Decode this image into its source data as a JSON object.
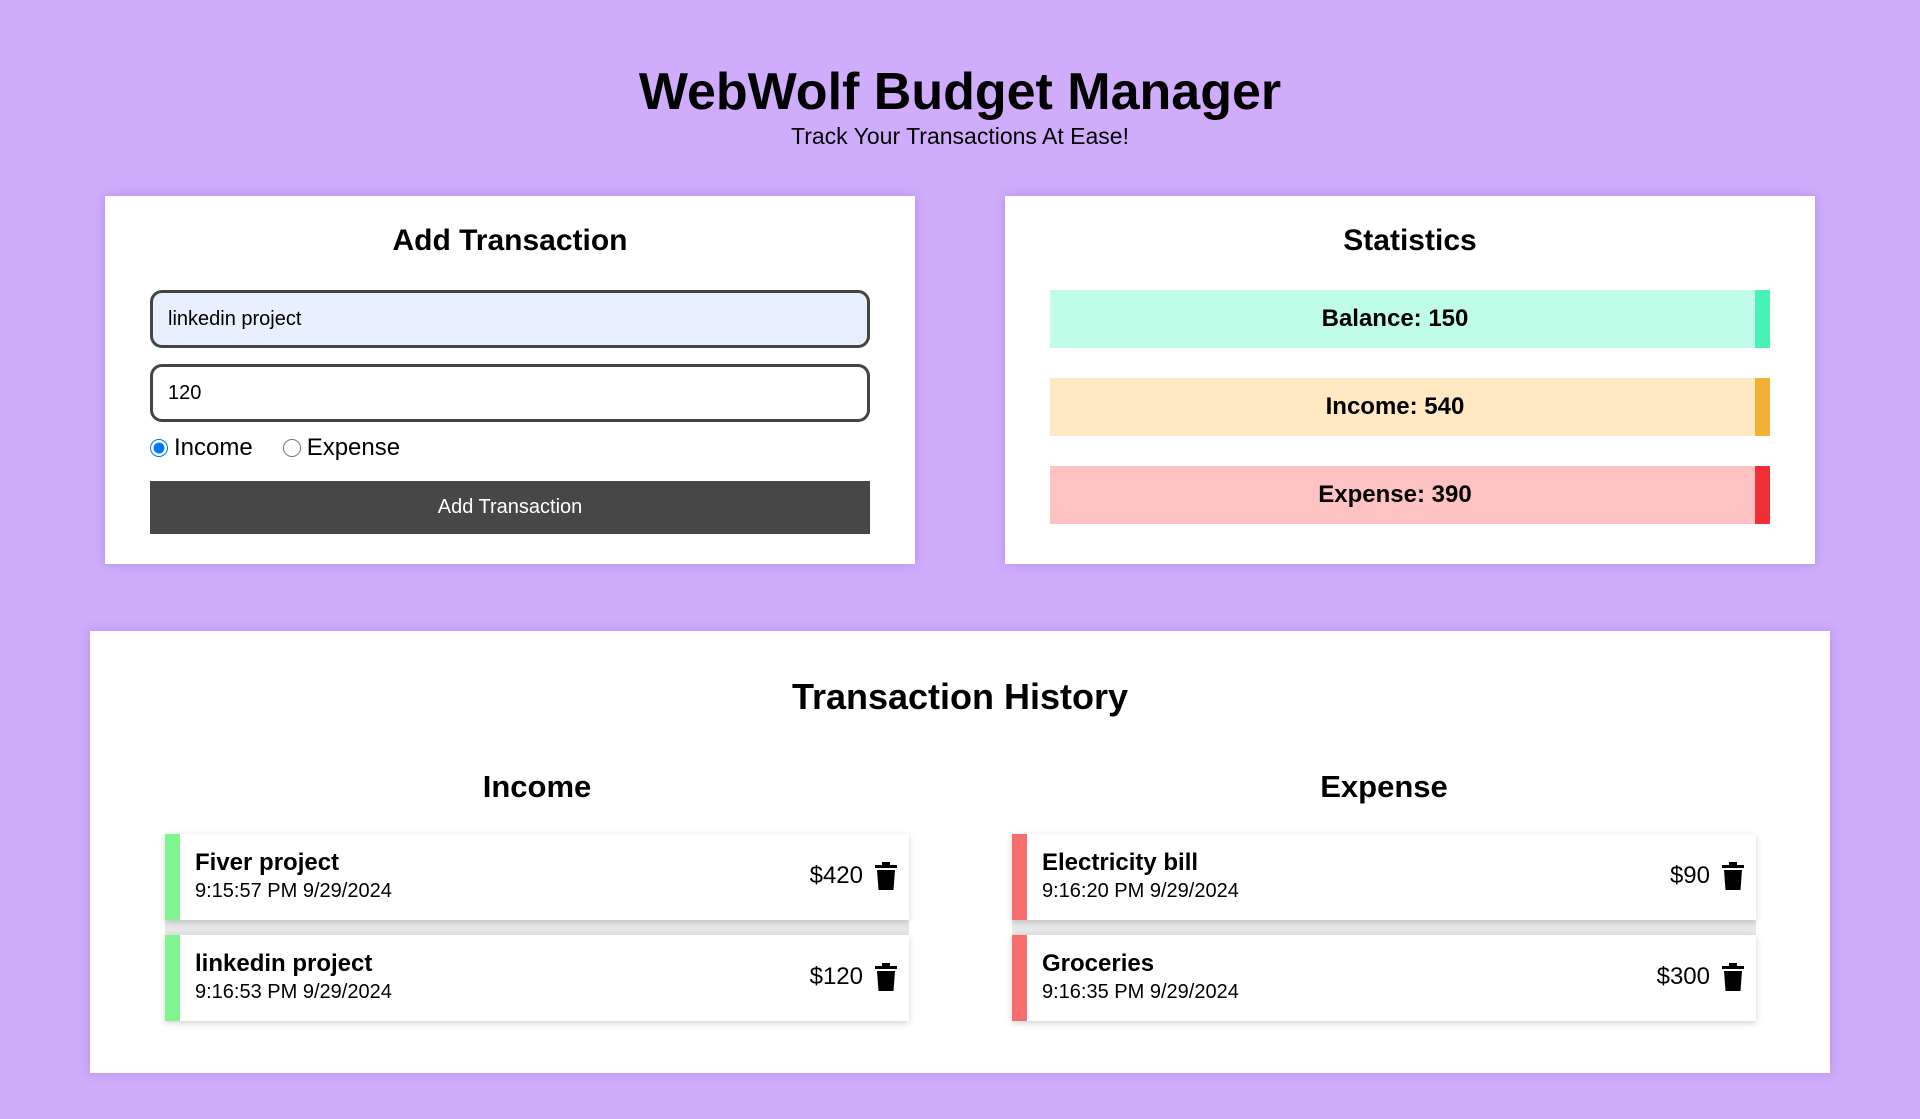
{
  "header": {
    "title": "WebWolf Budget Manager",
    "subtitle": "Track Your Transactions At Ease!"
  },
  "add_transaction": {
    "title": "Add Transaction",
    "description_value": "linkedin project",
    "amount_value": "120",
    "type_options": [
      "Income",
      "Expense"
    ],
    "selected_type": "Income",
    "button_label": "Add Transaction"
  },
  "statistics": {
    "title": "Statistics",
    "balance_label": "Balance: 150",
    "income_label": "Income: 540",
    "expense_label": "Expense: 390",
    "colors": {
      "balance_bg": "#c0fde9",
      "balance_accent": "#47f2b4",
      "income_bg": "#ffe8c2",
      "income_accent": "#f1b036",
      "expense_bg": "#ffc2c2",
      "expense_accent": "#ef2f35"
    }
  },
  "history": {
    "title": "Transaction History",
    "income": {
      "title": "Income",
      "items": [
        {
          "name": "Fiver project",
          "time": "9:15:57 PM 9/29/2024",
          "amount": "$420"
        },
        {
          "name": "linkedin project",
          "time": "9:16:53 PM 9/29/2024",
          "amount": "$120"
        }
      ]
    },
    "expense": {
      "title": "Expense",
      "items": [
        {
          "name": "Electricity bill",
          "time": "9:16:20 PM 9/29/2024",
          "amount": "$90"
        },
        {
          "name": "Groceries",
          "time": "9:16:35 PM 9/29/2024",
          "amount": "$300"
        }
      ]
    },
    "delete_icon": "trash-icon"
  },
  "theme": {
    "background": "#cfadfc",
    "button_bg": "#474747"
  }
}
